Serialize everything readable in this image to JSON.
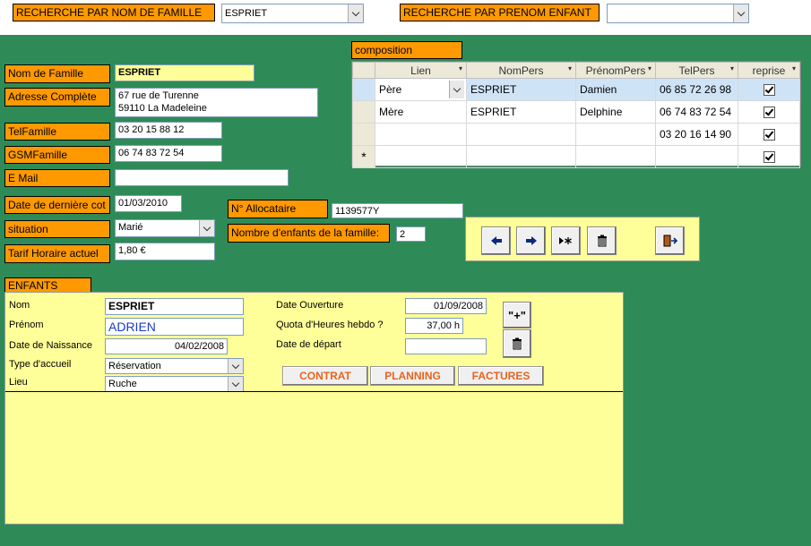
{
  "search": {
    "nom_label": "RECHERCHE PAR NOM DE FAMILLE",
    "nom_value": "ESPRIET",
    "prenom_label": "RECHERCHE PAR PRENOM ENFANT",
    "prenom_value": ""
  },
  "famille": {
    "nom_label": "Nom de Famille",
    "nom_value": "ESPRIET",
    "adresse_label": "Adresse Complète",
    "adresse_line1": "67 rue de Turenne",
    "adresse_line2": "59110 La Madeleine",
    "tel_label": "TelFamille",
    "tel_value": "03 20 15 88 12",
    "gsm_label": "GSMFamille",
    "gsm_value": "06 74 83 72 54",
    "email_label": "E Mail",
    "email_value": "",
    "date_label": "Date de dernière cot",
    "date_value": "01/03/2010",
    "situation_label": "situation",
    "situation_value": "Marié",
    "tarif_label": "Tarif Horaire actuel",
    "tarif_value": "1,80 €",
    "allocataire_label": "N° Allocataire",
    "allocataire_value": "1139577Y",
    "nb_enfants_label": "Nombre d'enfants de la famille:",
    "nb_enfants_value": "2"
  },
  "composition": {
    "title": "composition",
    "columns": [
      "Lien",
      "NomPers",
      "PrénomPers",
      "TelPers",
      "reprise"
    ],
    "rows": [
      {
        "lien": "Père",
        "nom": "ESPRIET",
        "prenom": "Damien",
        "tel": "06 85 72 26 98",
        "reprise": true
      },
      {
        "lien": "Mère",
        "nom": "ESPRIET",
        "prenom": "Delphine",
        "tel": "06 74 83 72 54",
        "reprise": true
      },
      {
        "lien": "",
        "nom": "",
        "prenom": "",
        "tel": "03 20 16 14 90",
        "reprise": true
      },
      {
        "lien": "",
        "nom": "",
        "prenom": "",
        "tel": "",
        "reprise": true
      }
    ],
    "new_row_marker": "*"
  },
  "enfants": {
    "title": "ENFANTS",
    "nom_label": "Nom",
    "nom_value": "ESPRIET",
    "prenom_label": "Prénom",
    "prenom_value": "ADRIEN",
    "naissance_label": "Date de Naissance",
    "naissance_value": "04/02/2008",
    "accueil_label": "Type d'accueil",
    "accueil_value": "Réservation",
    "lieu_label": "Lieu",
    "lieu_value": "Ruche",
    "ouverture_label": "Date Ouverture",
    "ouverture_value": "01/09/2008",
    "quota_label": "Quota d'Heures hebdo ?",
    "quota_value": "37,00 h",
    "depart_label": "Date de départ",
    "depart_value": "",
    "add_label": "\"+\"",
    "contrat_label": "CONTRAT",
    "planning_label": "PLANNING",
    "factures_label": "FACTURES"
  },
  "colors": {
    "background": "#2e8b57",
    "label_orange": "#ff9900",
    "panel_yellow": "#ffff99",
    "action_text": "#e8641e"
  }
}
